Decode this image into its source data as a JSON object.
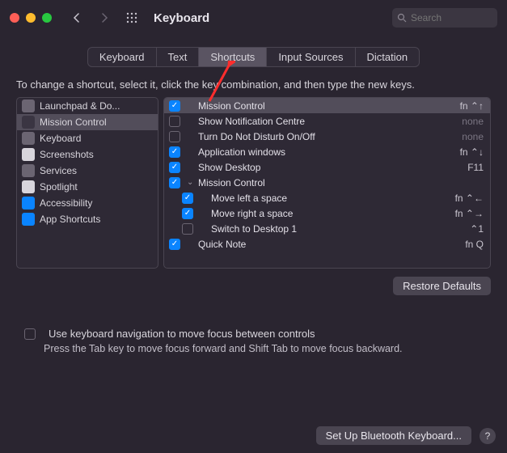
{
  "titlebar": {
    "title": "Keyboard",
    "search_placeholder": "Search"
  },
  "tabs": [
    {
      "label": "Keyboard",
      "selected": false
    },
    {
      "label": "Text",
      "selected": false
    },
    {
      "label": "Shortcuts",
      "selected": true
    },
    {
      "label": "Input Sources",
      "selected": false
    },
    {
      "label": "Dictation",
      "selected": false
    }
  ],
  "instruction": "To change a shortcut, select it, click the key combination, and then type the new keys.",
  "sidebar": [
    {
      "label": "Launchpad & Do...",
      "selected": false,
      "icon_color": "#6b6572"
    },
    {
      "label": "Mission Control",
      "selected": true,
      "icon_color": "#3a3542"
    },
    {
      "label": "Keyboard",
      "selected": false,
      "icon_color": "#6b6572"
    },
    {
      "label": "Screenshots",
      "selected": false,
      "icon_color": "#d8d5dc"
    },
    {
      "label": "Services",
      "selected": false,
      "icon_color": "#6b6572"
    },
    {
      "label": "Spotlight",
      "selected": false,
      "icon_color": "#d8d5dc"
    },
    {
      "label": "Accessibility",
      "selected": false,
      "icon_color": "#0a84ff"
    },
    {
      "label": "App Shortcuts",
      "selected": false,
      "icon_color": "#0a84ff"
    }
  ],
  "shortcuts": [
    {
      "checked": true,
      "indent": 0,
      "disclosure": "",
      "label": "Mission Control",
      "shortcut": "fn ⌃↑",
      "none": false,
      "selected": true
    },
    {
      "checked": false,
      "indent": 0,
      "disclosure": "",
      "label": "Show Notification Centre",
      "shortcut": "none",
      "none": true,
      "selected": false
    },
    {
      "checked": false,
      "indent": 0,
      "disclosure": "",
      "label": "Turn Do Not Disturb On/Off",
      "shortcut": "none",
      "none": true,
      "selected": false
    },
    {
      "checked": true,
      "indent": 0,
      "disclosure": "",
      "label": "Application windows",
      "shortcut": "fn ⌃↓",
      "none": false,
      "selected": false
    },
    {
      "checked": true,
      "indent": 0,
      "disclosure": "",
      "label": "Show Desktop",
      "shortcut": "F11",
      "none": false,
      "selected": false
    },
    {
      "checked": true,
      "indent": 0,
      "disclosure": "⌄",
      "label": "Mission Control",
      "shortcut": "",
      "none": false,
      "selected": false
    },
    {
      "checked": true,
      "indent": 1,
      "disclosure": "",
      "label": "Move left a space",
      "shortcut": "fn ⌃←",
      "none": false,
      "selected": false
    },
    {
      "checked": true,
      "indent": 1,
      "disclosure": "",
      "label": "Move right a space",
      "shortcut": "fn ⌃→",
      "none": false,
      "selected": false
    },
    {
      "checked": false,
      "indent": 1,
      "disclosure": "",
      "label": "Switch to Desktop 1",
      "shortcut": "⌃1",
      "none": false,
      "selected": false
    },
    {
      "checked": true,
      "indent": 0,
      "disclosure": "",
      "label": "Quick Note",
      "shortcut": "fn Q",
      "none": false,
      "selected": false
    }
  ],
  "buttons": {
    "restore": "Restore Defaults",
    "bluetooth": "Set Up Bluetooth Keyboard...",
    "help": "?"
  },
  "nav_checkbox": {
    "label": "Use keyboard navigation to move focus between controls",
    "hint": "Press the Tab key to move focus forward and Shift Tab to move focus backward.",
    "checked": false
  }
}
